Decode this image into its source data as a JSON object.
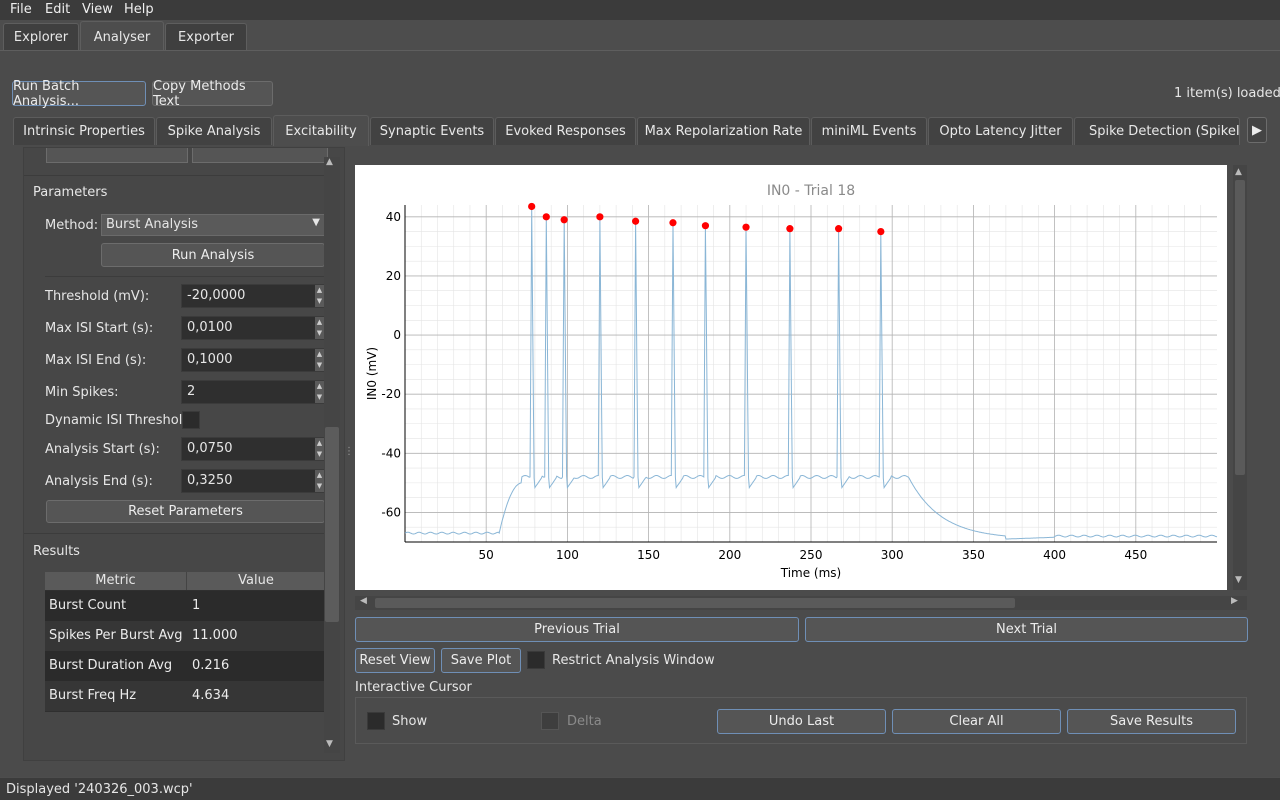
{
  "menu": {
    "file": "File",
    "edit": "Edit",
    "view": "View",
    "help": "Help"
  },
  "main_tabs": [
    "Explorer",
    "Analyser",
    "Exporter"
  ],
  "toolbar": {
    "run_batch": "Run Batch Analysis...",
    "copy_methods": "Copy Methods Text",
    "items_loaded": "1 item(s) loaded"
  },
  "sub_tabs": [
    "Intrinsic Properties",
    "Spike Analysis",
    "Excitability",
    "Synaptic Events",
    "Evoked Responses",
    "Max Repolarization Rate",
    "miniML Events",
    "Opto Latency Jitter",
    "Spike Detection (SpikeInt"
  ],
  "params": {
    "section_title": "Parameters",
    "method_label": "Method:",
    "method_value": "Burst Analysis",
    "run_analysis": "Run Analysis",
    "threshold_label": "Threshold (mV):",
    "threshold_value": "-20,0000",
    "max_isi_start_label": "Max ISI Start (s):",
    "max_isi_start_value": "0,0100",
    "max_isi_end_label": "Max ISI End (s):",
    "max_isi_end_value": "0,1000",
    "min_spikes_label": "Min Spikes:",
    "min_spikes_value": "2",
    "dynamic_isi_label": "Dynamic ISI Threshold",
    "analysis_start_label": "Analysis Start (s):",
    "analysis_start_value": "0,0750",
    "analysis_end_label": "Analysis End (s):",
    "analysis_end_value": "0,3250",
    "reset_params": "Reset Parameters"
  },
  "results": {
    "section_title": "Results",
    "headers": [
      "Metric",
      "Value"
    ],
    "rows": [
      {
        "metric": "Burst Count",
        "value": "1"
      },
      {
        "metric": "Spikes Per Burst Avg",
        "value": "11.000"
      },
      {
        "metric": "Burst Duration Avg",
        "value": "0.216"
      },
      {
        "metric": "Burst Freq Hz",
        "value": "4.634"
      }
    ]
  },
  "chart_data": {
    "type": "line",
    "title": "IN0 - Trial 18",
    "xlabel": "Time (ms)",
    "ylabel": "IN0 (mV)",
    "xlim": [
      0,
      500
    ],
    "ylim": [
      -70,
      44
    ],
    "xticks": [
      50,
      100,
      150,
      200,
      250,
      300,
      350,
      400,
      450
    ],
    "yticks": [
      40,
      20,
      0,
      -20,
      -40,
      -60
    ],
    "grid": true,
    "trace_color": "#8ab6d6",
    "marker_color": "#ff0000",
    "baseline_mv": -67,
    "plateau_mv": -48,
    "stim_start_ms": 58,
    "stim_end_ms": 310,
    "spikes": [
      {
        "t": 78,
        "peak": 43.5
      },
      {
        "t": 87,
        "peak": 40
      },
      {
        "t": 98,
        "peak": 39
      },
      {
        "t": 120,
        "peak": 40
      },
      {
        "t": 142,
        "peak": 38.5
      },
      {
        "t": 165,
        "peak": 38
      },
      {
        "t": 185,
        "peak": 37
      },
      {
        "t": 210,
        "peak": 36.5
      },
      {
        "t": 237,
        "peak": 36
      },
      {
        "t": 267,
        "peak": 36
      },
      {
        "t": 293,
        "peak": 35
      }
    ]
  },
  "nav": {
    "prev": "Previous Trial",
    "next": "Next Trial",
    "reset_view": "Reset View",
    "save_plot": "Save Plot",
    "restrict": "Restrict Analysis Window"
  },
  "cursor": {
    "section_title": "Interactive Cursor",
    "show": "Show",
    "delta": "Delta",
    "undo": "Undo Last",
    "clear": "Clear All",
    "save": "Save Results"
  },
  "status": "Displayed '240326_003.wcp'"
}
